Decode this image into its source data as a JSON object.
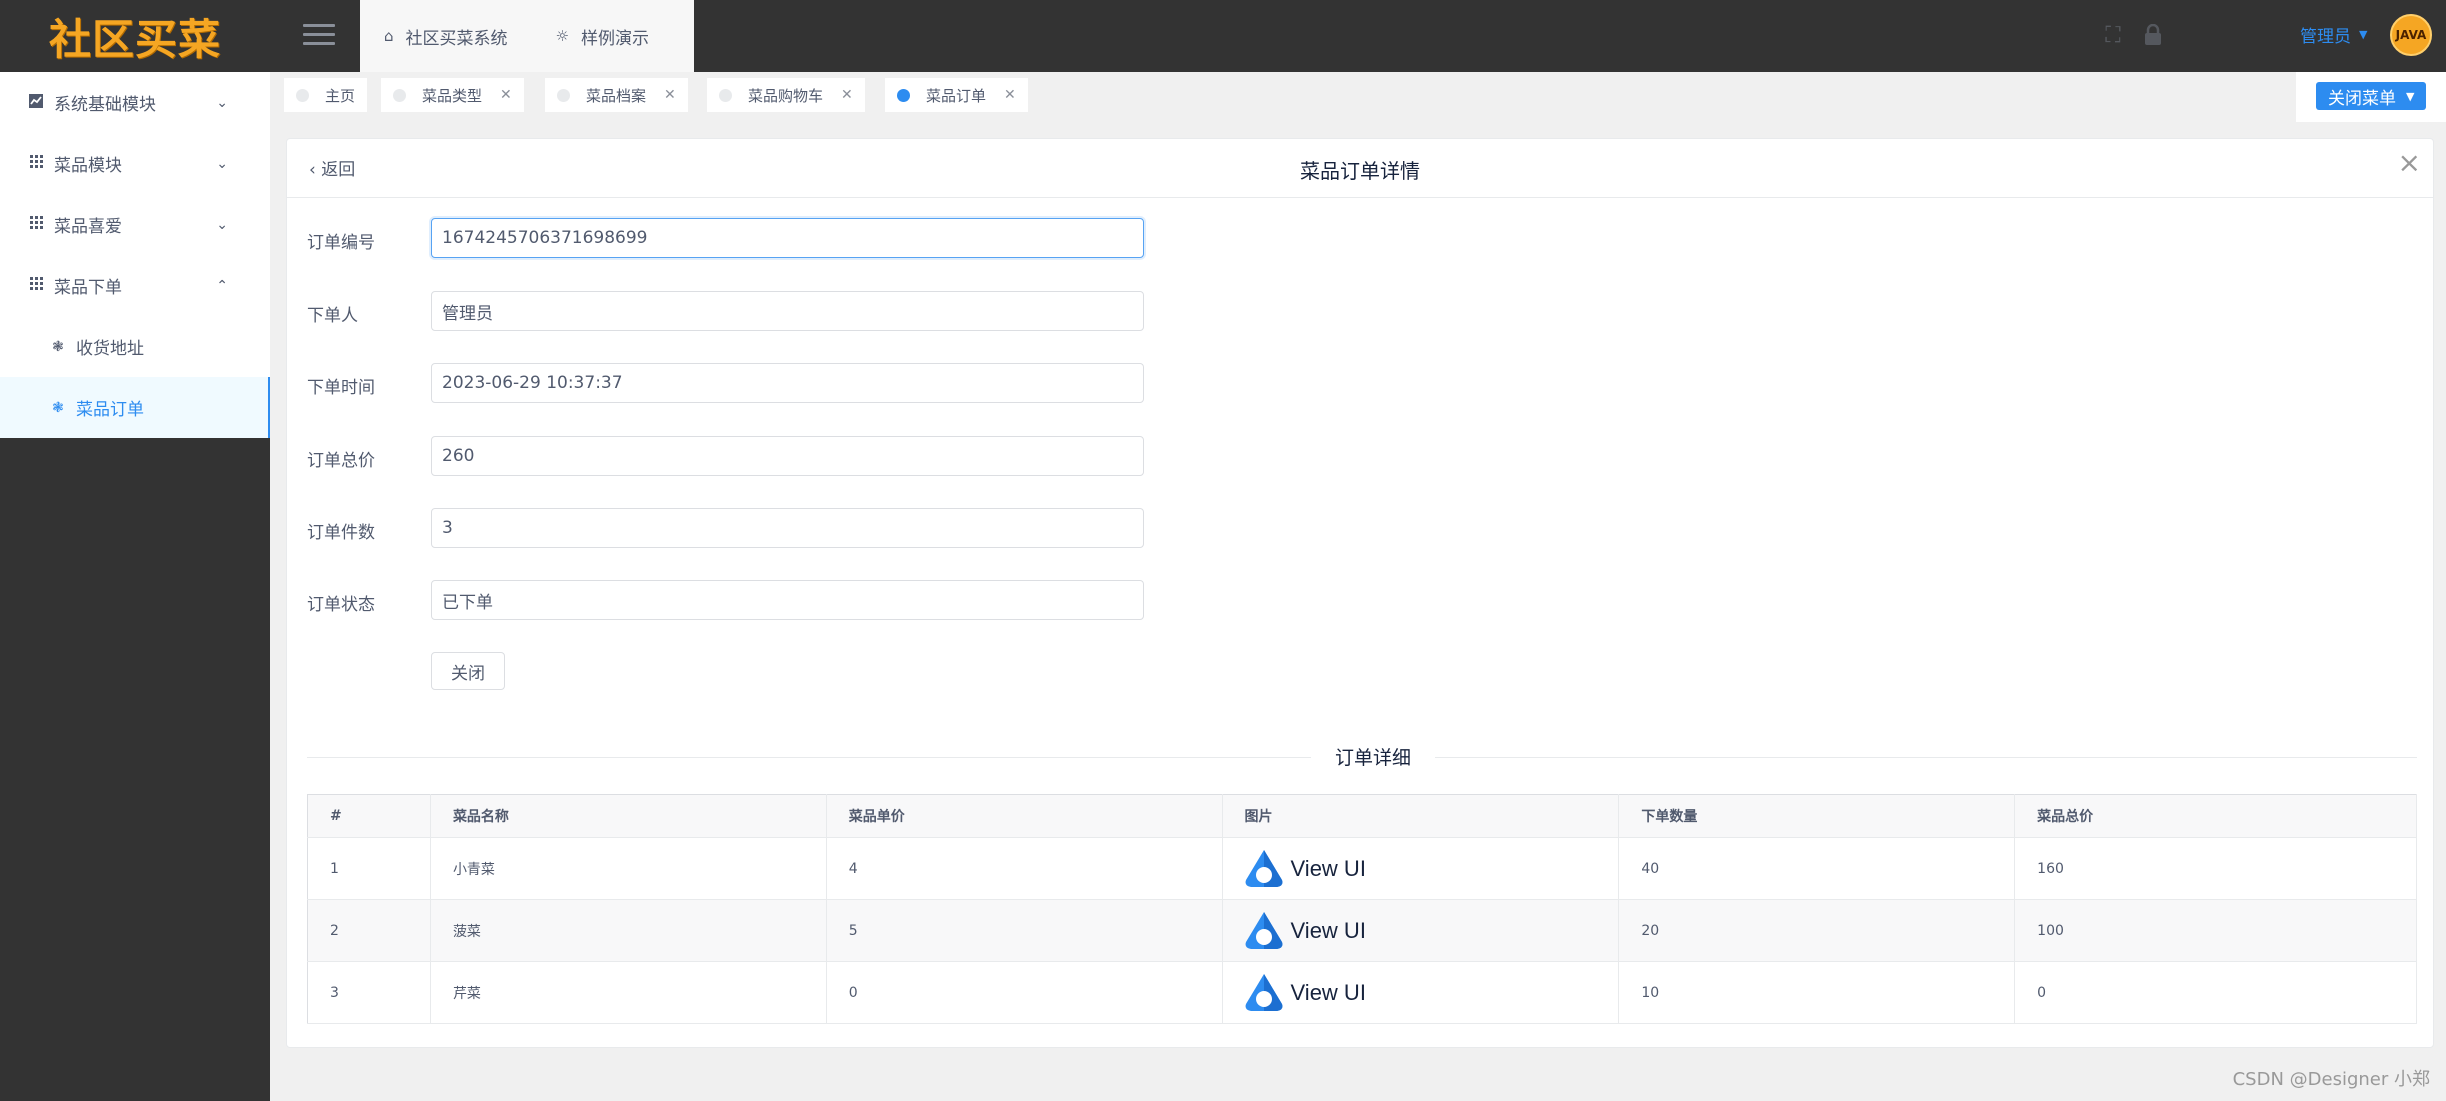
{
  "app": {
    "logo_text": "社区买菜"
  },
  "header": {
    "nav": [
      {
        "label": "社区买菜系统",
        "icon": "home-icon"
      },
      {
        "label": "样例演示",
        "icon": "bulb-icon"
      }
    ],
    "user_label": "管理员",
    "avatar_text": "JAVA"
  },
  "sidebar": {
    "items": [
      {
        "label": "系统基础模块",
        "icon": "chart-icon",
        "expanded": false
      },
      {
        "label": "菜品模块",
        "icon": "grid-icon",
        "expanded": false
      },
      {
        "label": "菜品喜爱",
        "icon": "grid-icon",
        "expanded": false
      },
      {
        "label": "菜品下单",
        "icon": "grid-icon",
        "expanded": true
      },
      {
        "label": "收货地址",
        "icon": "aperture-icon",
        "sub": true
      },
      {
        "label": "菜品订单",
        "icon": "aperture-icon",
        "sub": true,
        "active": true
      }
    ]
  },
  "tabs": [
    {
      "label": "主页",
      "closable": false,
      "active": false
    },
    {
      "label": "菜品类型",
      "closable": true,
      "active": false
    },
    {
      "label": "菜品档案",
      "closable": true,
      "active": false
    },
    {
      "label": "菜品购物车",
      "closable": true,
      "active": false
    },
    {
      "label": "菜品订单",
      "closable": true,
      "active": true
    }
  ],
  "close_menu_label": "关闭菜单",
  "detail": {
    "back_label": "返回",
    "title": "菜品订单详情",
    "fields": [
      {
        "label": "订单编号",
        "value": "1674245706371698699"
      },
      {
        "label": "下单人",
        "value": "管理员"
      },
      {
        "label": "下单时间",
        "value": "2023-06-29 10:37:37"
      },
      {
        "label": "订单总价",
        "value": "260"
      },
      {
        "label": "订单件数",
        "value": "3"
      },
      {
        "label": "订单状态",
        "value": "已下单"
      }
    ],
    "close_button": "关闭",
    "section_title": "订单详细",
    "table": {
      "headers": [
        "#",
        "菜品名称",
        "菜品单价",
        "图片",
        "下单数量",
        "菜品总价"
      ],
      "rows": [
        {
          "no": "1",
          "name": "小青菜",
          "price": "4",
          "image_text": "View UI",
          "qty": "40",
          "total": "160"
        },
        {
          "no": "2",
          "name": "菠菜",
          "price": "5",
          "image_text": "View UI",
          "qty": "20",
          "total": "100"
        },
        {
          "no": "3",
          "name": "芹菜",
          "price": "0",
          "image_text": "View UI",
          "qty": "10",
          "total": "0"
        }
      ]
    }
  },
  "watermark": "CSDN @Designer 小郑",
  "colors": {
    "primary": "#2d8cf0",
    "header_bg": "#333333",
    "logo": "#f5a623"
  }
}
